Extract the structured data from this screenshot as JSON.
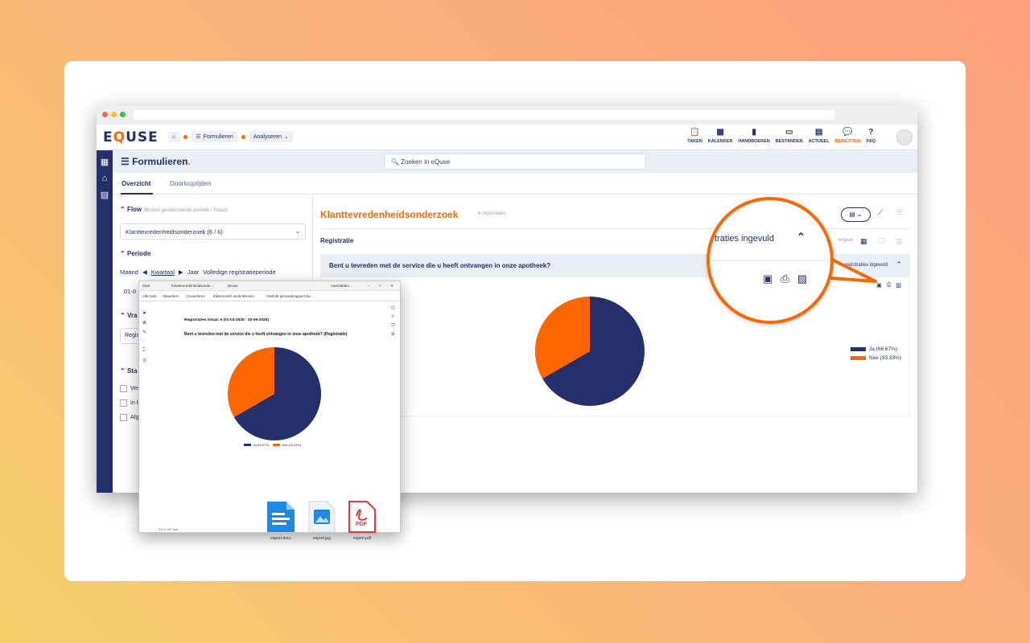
{
  "brand": {
    "logo_pre": "E",
    "logo_q": "Q",
    "logo_post": "USE"
  },
  "breadcrumb": {
    "item1": "Formulieren",
    "item2": "Analyseren"
  },
  "nav": {
    "taken": "TAKEN",
    "kalender": "KALENDER",
    "handboeken": "HANDBOEKEN",
    "bestanden": "BESTANDEN",
    "actueel": "ACTUEEL",
    "berichten": "BERICHTEN",
    "faq": "FAQ"
  },
  "header": {
    "title": "Formulieren",
    "title_dot": ".",
    "search_placeholder": "Zoeken in eQuse"
  },
  "tabs": {
    "overzicht": "Overzicht",
    "doorlooptijden": "Doorlooptijden"
  },
  "left": {
    "flow_label": "Flow",
    "flow_sub": "(Binnen geselecteerde periode / Totaal)",
    "flow_value": "Klanttevredenheidsonderzoek (6 / 6)",
    "periode_label": "Periode",
    "period_maand": "Maand",
    "period_kwartaal": "Kwartaal",
    "period_jaar": "Jaar",
    "period_volledig": "Volledige registratieperiode",
    "date_partial": "01-0",
    "vra_partial": "Vra",
    "regis_partial": "Regis",
    "sta_partial": "Sta",
    "cb1": "Ver",
    "cb2": "In b",
    "cb3": "Afg"
  },
  "main": {
    "title": "Klanttevredenheidsonderzoek",
    "subtitle": "6 registraties",
    "registratie": "Registratie",
    "weergave_partial": "ergave",
    "question": "Bent u tevreden met de service die u heeft ontvangen in onze apotheek?",
    "q_right": "registraties ingevuld"
  },
  "magnifier": {
    "title_partial": "traties ingevuld"
  },
  "pdf": {
    "tab1": "Start",
    "tab2": "Klanttevredenheidsonde...",
    "tab3": "Nieuw",
    "signin": "Aanmelden",
    "tb1": "Alle tools",
    "tb2": "Bewerken",
    "tb3": "Converteren",
    "tb4": "Elektronisch ondertekenen",
    "tb5": "Vindt dit gemoedsrapport die...",
    "total": "Registraties totaal: 6 (01-04-2025 - 30-06-2025)",
    "question": "Bent u tevreden met de service die u heeft ontvangen in onze apotheek? (Registratie)",
    "status": "210 x 297 mm"
  },
  "files": {
    "docx": "export.docx",
    "jpg": "export.jpg",
    "pdf": "export.pdf",
    "pdf_badge": "PDF"
  },
  "colors": {
    "navy": "#25306a",
    "orange": "#ff6600",
    "light": "#e9eff5"
  },
  "chart_data": {
    "type": "pie",
    "categories": [
      "Ja (66.67%)",
      "Nee (33.33%)"
    ],
    "values": [
      66.67,
      33.33
    ],
    "colors": [
      "#25306a",
      "#ff6600"
    ],
    "legend": "right"
  },
  "pdf_chart": {
    "type": "pie",
    "categories": [
      "Ja (66.67%)",
      "Nee (33.33%)"
    ],
    "values": [
      66.67,
      33.33
    ],
    "colors": [
      "#25306a",
      "#ff6600"
    ]
  }
}
